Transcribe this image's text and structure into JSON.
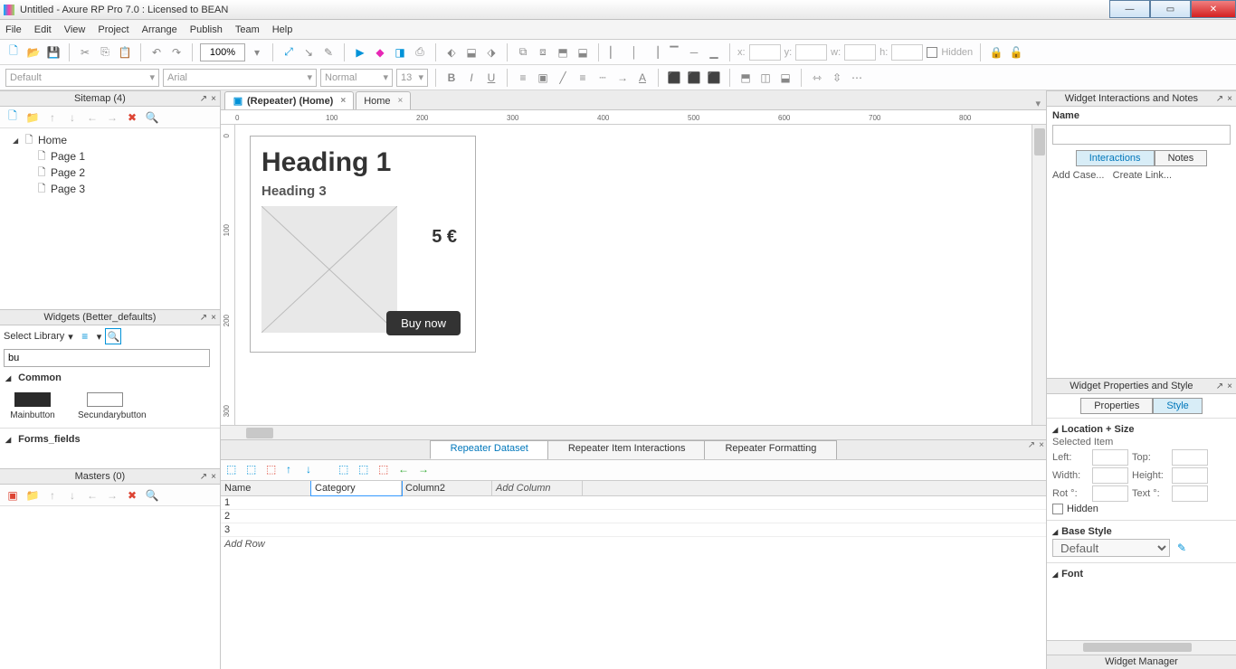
{
  "app": {
    "title": "Untitled - Axure RP Pro 7.0 : Licensed to BEAN"
  },
  "menu": [
    "File",
    "Edit",
    "View",
    "Project",
    "Arrange",
    "Publish",
    "Team",
    "Help"
  ],
  "toolbar1": {
    "zoom": "100%",
    "pos": {
      "x_lbl": "x:",
      "y_lbl": "y:",
      "w_lbl": "w:",
      "h_lbl": "h:"
    },
    "hidden": "Hidden"
  },
  "toolbar2": {
    "style": "Default",
    "font": "Arial",
    "weight": "Normal",
    "size": "13"
  },
  "sitemap": {
    "title": "Sitemap (4)",
    "items": [
      {
        "label": "Home",
        "children": [
          {
            "label": "Page 1"
          },
          {
            "label": "Page 2"
          },
          {
            "label": "Page 3"
          }
        ]
      }
    ]
  },
  "widgets_panel": {
    "title": "Widgets (Better_defaults)",
    "select_lib": "Select Library",
    "filter": "bu",
    "sections": {
      "common": "Common",
      "forms": "Forms_fields"
    },
    "items": {
      "main": "Mainbutton",
      "secondary": "Secundarybutton"
    }
  },
  "masters": {
    "title": "Masters (0)"
  },
  "canvas": {
    "tabs": [
      {
        "label": "(Repeater) (Home)",
        "active": true
      },
      {
        "label": "Home",
        "active": false
      }
    ],
    "repeater": {
      "h1": "Heading 1",
      "h3": "Heading 3",
      "price": "5 €",
      "button": "Buy now"
    }
  },
  "repeater_panel": {
    "tabs": [
      "Repeater Dataset",
      "Repeater Item Interactions",
      "Repeater Formatting"
    ],
    "columns": [
      "Name",
      "Category",
      "Column2"
    ],
    "add_column": "Add Column",
    "rows": [
      "1",
      "2",
      "3"
    ],
    "add_row": "Add Row"
  },
  "right": {
    "interactions": {
      "title": "Widget Interactions and Notes",
      "name_lbl": "Name",
      "tabs": [
        "Interactions",
        "Notes"
      ],
      "add_case": "Add Case...",
      "create_link": "Create Link..."
    },
    "props": {
      "title": "Widget Properties and Style",
      "tabs": [
        "Properties",
        "Style"
      ],
      "loc_size": "Location + Size",
      "selected": "Selected Item",
      "left": "Left:",
      "top": "Top:",
      "width": "Width:",
      "height": "Height:",
      "rot": "Rot °:",
      "text": "Text °:",
      "hidden": "Hidden",
      "base": "Base Style",
      "default": "Default",
      "font": "Font"
    },
    "manager": "Widget Manager"
  }
}
